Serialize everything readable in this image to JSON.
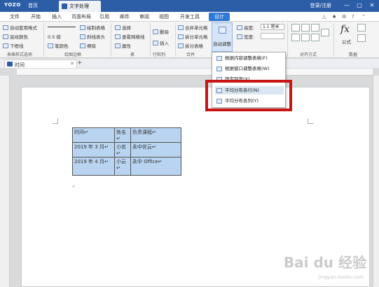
{
  "titlebar": {
    "logo": "YOZO",
    "home_tab": "首页",
    "doc_tab": "文字处理",
    "login": "登录/注册",
    "win_btns": [
      "—",
      "□",
      "✕"
    ]
  },
  "menubar": {
    "items": [
      "文件",
      "开始",
      "插入",
      "页面布局",
      "引用",
      "邮件",
      "审阅",
      "视图",
      "开发工具"
    ],
    "active": "设计"
  },
  "ribbon": {
    "col1": [
      "自动套用格式",
      "底纹颜色",
      "下框线"
    ],
    "group1": "表格样式选项",
    "line_width": "0.5 磅",
    "pen_color": "笔颜色",
    "draw_table": "绘制表格",
    "diag_header": "斜线表头",
    "eraser": "擦除",
    "group2": "绘图边框",
    "select": "选择",
    "gridlines": "查看网格线",
    "properties": "属性",
    "group3": "表",
    "delete": "删除",
    "insert": "插入",
    "group4": "行和列",
    "merge": "合并单元格",
    "split_cells": "拆分单元格",
    "split_table": "拆分表格",
    "group5": "合并",
    "autofit": "自动调整",
    "height_label": "高度:",
    "height_value": "1.1 厘米",
    "width_label": "宽度:",
    "width_value": "",
    "group6": "对齐方式",
    "formula_label": "公式",
    "group7": "数据",
    "fx": "fx"
  },
  "dropdown": {
    "items": [
      "根据内容调整表格(F)",
      "根据窗口调整表格(W)",
      "固定列宽(X)",
      "平均分布各行(N)",
      "平均分布各列(Y)"
    ]
  },
  "doc": {
    "tab_title": "时间",
    "table": [
      [
        "时间↵",
        "姓名↵",
        "负责课程↵"
      ],
      [
        "2019 年 3 月↵",
        "小优↵",
        "永中优云↵"
      ],
      [
        "2019 年 4 月↵",
        "小云↵",
        "永中 Office↵"
      ]
    ],
    "cell_mark": "↵"
  },
  "watermark": {
    "main": "Bai du 经验",
    "sub": "jingyan.baidu.com"
  },
  "colors": {
    "brand": "#2c5ea8",
    "accent": "#2c7ad6",
    "highlight": "#c91414",
    "selection": "#b9d4f1"
  }
}
